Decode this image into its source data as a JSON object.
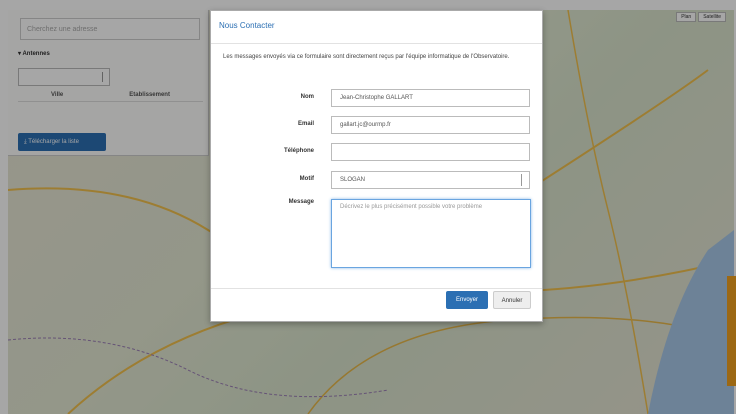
{
  "sidebar": {
    "search_placeholder": "Cherchez une adresse",
    "section_title": "Antennes",
    "columns": [
      "Ville",
      "Etablissement"
    ],
    "download_label": "Télécharger la liste"
  },
  "map": {
    "types": [
      "Plan",
      "Satellite"
    ]
  },
  "modal": {
    "title": "Nous Contacter",
    "intro": "Les messages envoyés via ce formulaire sont directement reçus par l'équipe informatique de l'Observatoire.",
    "fields": {
      "nom": {
        "label": "Nom",
        "value": "Jean-Christophe GALLART"
      },
      "email": {
        "label": "Email",
        "value": "gallart.jc@ourmp.fr"
      },
      "telephone": {
        "label": "Téléphone",
        "value": ""
      },
      "motif": {
        "label": "Motif",
        "value": "SLOGAN"
      },
      "message": {
        "label": "Message",
        "placeholder": "Décrivez le plus précisément possible votre problème"
      }
    },
    "submit_label": "Envoyer",
    "cancel_label": "Annuler"
  },
  "colors": {
    "primary": "#2b6fb3",
    "accent_tab": "#f0a020"
  }
}
